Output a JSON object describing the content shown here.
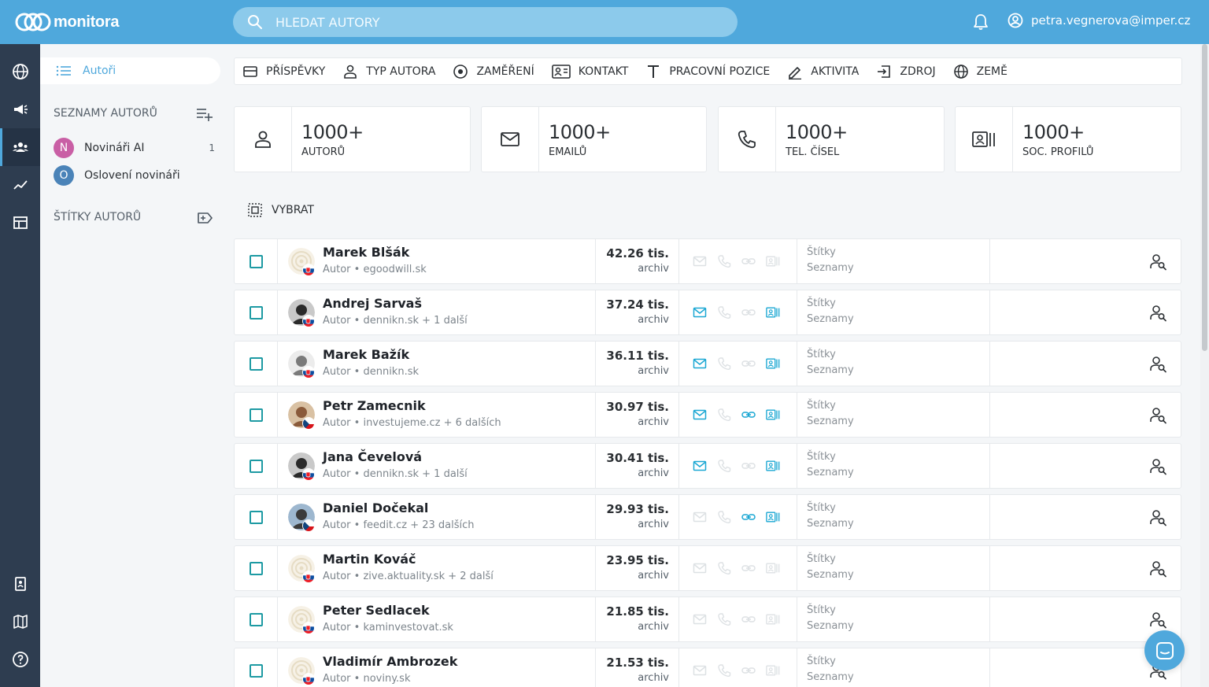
{
  "header": {
    "logo_text": "monitora",
    "search_placeholder": "HLEDAT AUTORY",
    "user_email": "petra.vegnerova@imper.cz"
  },
  "sidebar": {
    "active_item": "Autoři",
    "lists_heading": "SEZNAMY AUTORŮ",
    "lists": [
      {
        "letter": "N",
        "label": "Novináři AI",
        "count": "1",
        "color": "#c95fa5"
      },
      {
        "letter": "O",
        "label": "Oslovení novináři",
        "count": "",
        "color": "#4a83b8"
      }
    ],
    "tags_heading": "ŠTÍTKY AUTORŮ"
  },
  "filters": [
    {
      "icon": "post-icon",
      "label": "PŘÍSPĚVKY"
    },
    {
      "icon": "person-icon",
      "label": "TYP AUTORA"
    },
    {
      "icon": "target-icon",
      "label": "ZAMĚŘENÍ"
    },
    {
      "icon": "contact-card-icon",
      "label": "KONTAKT"
    },
    {
      "icon": "text-icon",
      "label": "PRACOVNÍ POZICE"
    },
    {
      "icon": "pencil-icon",
      "label": "AKTIVITA"
    },
    {
      "icon": "source-icon",
      "label": "ZDROJ"
    },
    {
      "icon": "globe-icon",
      "label": "ZEMĚ"
    }
  ],
  "stats": [
    {
      "icon": "person-icon",
      "value": "1000+",
      "label": "AUTORŮ"
    },
    {
      "icon": "mail-icon",
      "value": "1000+",
      "label": "EMAILŮ"
    },
    {
      "icon": "phone-icon",
      "value": "1000+",
      "label": "TEL. ČÍSEL"
    },
    {
      "icon": "social-profile-icon",
      "value": "1000+",
      "label": "SOC. PROFILŮ"
    }
  ],
  "select_label": "VYBRAT",
  "authors": [
    {
      "name": "Marek Blšák",
      "meta": "Autor • egoodwill.sk",
      "reach": "42.26 tis.",
      "reach_sub": "archiv",
      "flag": "sk",
      "avatar": "placeholder",
      "contacts": [
        false,
        false,
        false,
        false
      ],
      "tags": "Štítky",
      "lists": "Seznamy"
    },
    {
      "name": "Andrej Sarvaš",
      "meta": "Autor • dennikn.sk + 1 další",
      "reach": "37.24 tis.",
      "reach_sub": "archiv",
      "flag": "sk",
      "avatar": "dark",
      "contacts": [
        true,
        false,
        false,
        true
      ],
      "tags": "Štítky",
      "lists": "Seznamy"
    },
    {
      "name": "Marek Bažík",
      "meta": "Autor • dennikn.sk",
      "reach": "36.11 tis.",
      "reach_sub": "archiv",
      "flag": "sk",
      "avatar": "light",
      "contacts": [
        true,
        false,
        false,
        true
      ],
      "tags": "Štítky",
      "lists": "Seznamy"
    },
    {
      "name": "Petr Zamecnik",
      "meta": "Autor • investujeme.cz + 6 dalších",
      "reach": "30.97 tis.",
      "reach_sub": "archiv",
      "flag": "cz",
      "avatar": "warm",
      "contacts": [
        true,
        false,
        true,
        true
      ],
      "tags": "Štítky",
      "lists": "Seznamy"
    },
    {
      "name": "Jana Čevelová",
      "meta": "Autor • dennikn.sk + 1 další",
      "reach": "30.41 tis.",
      "reach_sub": "archiv",
      "flag": "sk",
      "avatar": "dark",
      "contacts": [
        true,
        false,
        false,
        true
      ],
      "tags": "Štítky",
      "lists": "Seznamy"
    },
    {
      "name": "Daniel Dočekal",
      "meta": "Autor • feedit.cz + 23 dalších",
      "reach": "29.93 tis.",
      "reach_sub": "archiv",
      "flag": "cz",
      "avatar": "photo",
      "contacts": [
        false,
        false,
        true,
        true
      ],
      "tags": "Štítky",
      "lists": "Seznamy"
    },
    {
      "name": "Martin Kováč",
      "meta": "Autor • zive.aktuality.sk + 2 další",
      "reach": "23.95 tis.",
      "reach_sub": "archiv",
      "flag": "sk",
      "avatar": "placeholder",
      "contacts": [
        false,
        false,
        false,
        false
      ],
      "tags": "Štítky",
      "lists": "Seznamy"
    },
    {
      "name": "Peter Sedlacek",
      "meta": "Autor • kaminvestovat.sk",
      "reach": "21.85 tis.",
      "reach_sub": "archiv",
      "flag": "sk",
      "avatar": "placeholder",
      "contacts": [
        false,
        false,
        false,
        false
      ],
      "tags": "Štítky",
      "lists": "Seznamy"
    },
    {
      "name": "Vladimír Ambrozek",
      "meta": "Autor • noviny.sk",
      "reach": "21.53 tis.",
      "reach_sub": "archiv",
      "flag": "sk",
      "avatar": "placeholder",
      "contacts": [
        false,
        false,
        false,
        false
      ],
      "tags": "Štítky",
      "lists": "Seznamy"
    }
  ],
  "colors": {
    "accent": "#4fa8dc",
    "checkbox": "#1d9aa3",
    "contact_active": "#1aa7d3",
    "contact_inactive": "#dde1e4",
    "rail": "#2e3d50"
  }
}
